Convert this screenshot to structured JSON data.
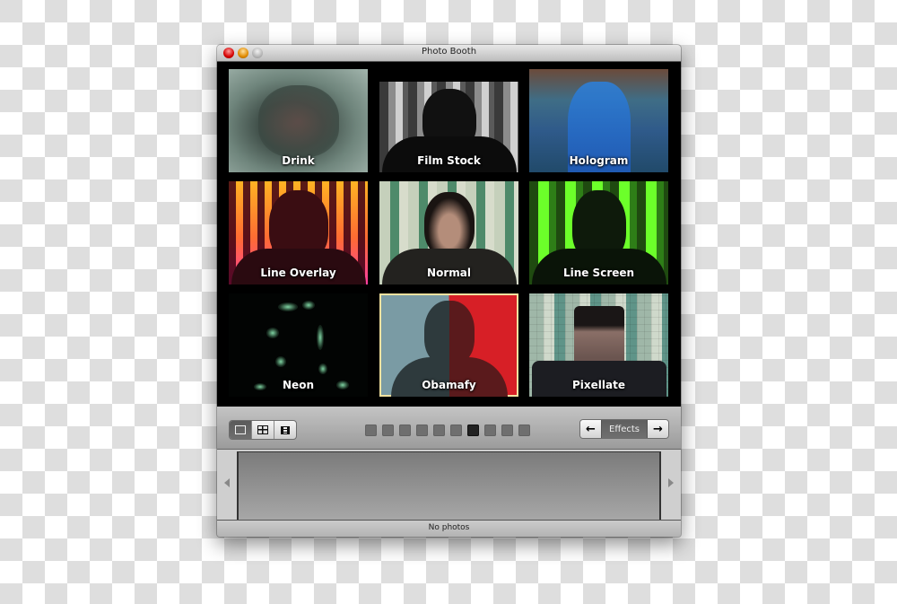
{
  "window": {
    "title": "Photo Booth"
  },
  "effects_grid": [
    {
      "label": "Drink",
      "selected": false
    },
    {
      "label": "Film Stock",
      "selected": false
    },
    {
      "label": "Hologram",
      "selected": false
    },
    {
      "label": "Line Overlay",
      "selected": false
    },
    {
      "label": "Normal",
      "selected": false
    },
    {
      "label": "Line Screen",
      "selected": false
    },
    {
      "label": "Neon",
      "selected": false
    },
    {
      "label": "Obamafy",
      "selected": true
    },
    {
      "label": "Pixellate",
      "selected": false
    }
  ],
  "toolbar": {
    "view_modes": [
      {
        "name": "single-photo",
        "active": true
      },
      {
        "name": "four-up",
        "active": false
      },
      {
        "name": "movie-clip",
        "active": false
      }
    ],
    "page_indicator": {
      "total_pages": 10,
      "current_page": 7
    },
    "effects_nav": {
      "prev_glyph": "🡐",
      "label": "Effects",
      "next_glyph": "🡒"
    }
  },
  "tray": {
    "left_glyph": "",
    "right_glyph": ""
  },
  "status": {
    "text": "No photos"
  },
  "colors": {
    "selection_outline": "#f2e2a0",
    "active_dot": "#222222",
    "inactive_dot": "#6f6f6f"
  }
}
